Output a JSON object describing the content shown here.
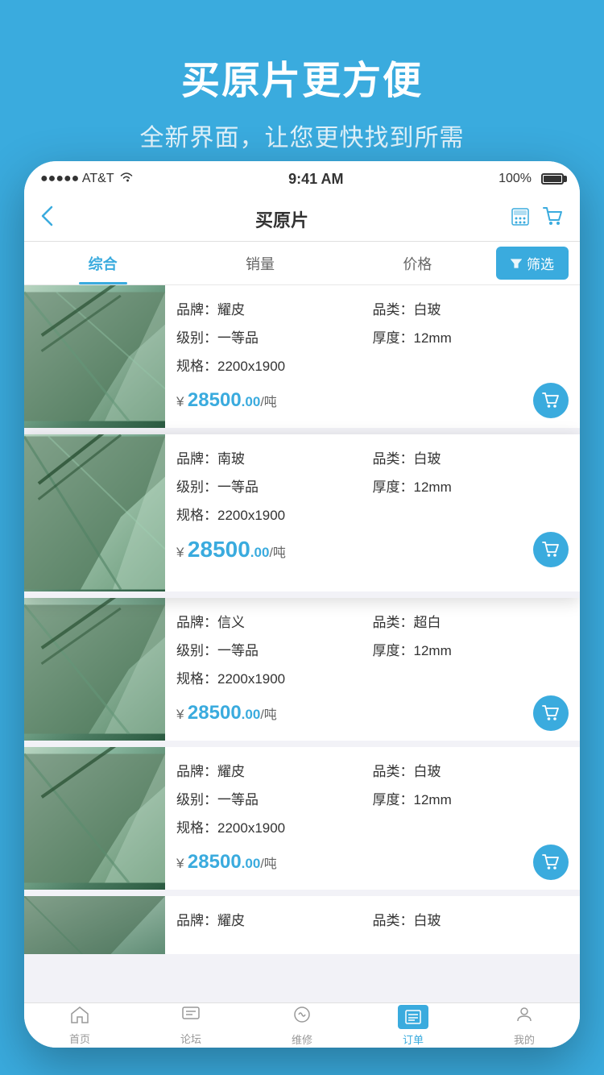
{
  "promo": {
    "title": "买原片更方便",
    "subtitle": "全新界面，让您更快找到所需"
  },
  "status_bar": {
    "carrier": "●●●●● AT&T",
    "wifi": "wifi",
    "time": "9:41 AM",
    "battery_pct": "100%"
  },
  "nav": {
    "back": "‹",
    "title": "买原片",
    "calc_icon": "calculator",
    "cart_icon": "cart"
  },
  "sort_tabs": [
    {
      "label": "综合",
      "active": true
    },
    {
      "label": "销量",
      "active": false
    },
    {
      "label": "价格",
      "active": false
    }
  ],
  "filter_btn": "筛选",
  "products": [
    {
      "brand_label": "品牌：",
      "brand_value": "耀皮",
      "category_label": "品类：",
      "category_value": "白玻",
      "grade_label": "级别：",
      "grade_value": "一等品",
      "thickness_label": "厚度：",
      "thickness_value": "12mm",
      "spec_label": "规格：",
      "spec_value": "2200x1900",
      "price_symbol": "¥",
      "price_main": "28500",
      "price_decimal": ".00",
      "price_unit": "/吨",
      "highlighted": false
    },
    {
      "brand_label": "品牌：",
      "brand_value": "南玻",
      "category_label": "品类：",
      "category_value": "白玻",
      "grade_label": "级别：",
      "grade_value": "一等品",
      "thickness_label": "厚度：",
      "thickness_value": "12mm",
      "spec_label": "规格：",
      "spec_value": "2200x1900",
      "price_symbol": "¥",
      "price_main": "28500",
      "price_decimal": ".00",
      "price_unit": "/吨",
      "highlighted": true
    },
    {
      "brand_label": "品牌：",
      "brand_value": "信义",
      "category_label": "品类：",
      "category_value": "超白",
      "grade_label": "级别：",
      "grade_value": "一等品",
      "thickness_label": "厚度：",
      "thickness_value": "12mm",
      "spec_label": "规格：",
      "spec_value": "2200x1900",
      "price_symbol": "¥",
      "price_main": "28500",
      "price_decimal": ".00",
      "price_unit": "/吨",
      "highlighted": false
    },
    {
      "brand_label": "品牌：",
      "brand_value": "耀皮",
      "category_label": "品类：",
      "category_value": "白玻",
      "grade_label": "级别：",
      "grade_value": "一等品",
      "thickness_label": "厚度：",
      "thickness_value": "12mm",
      "spec_label": "规格：",
      "spec_value": "2200x1900",
      "price_symbol": "¥",
      "price_main": "28500",
      "price_decimal": ".00",
      "price_unit": "/吨",
      "highlighted": false
    },
    {
      "brand_label": "品牌：",
      "brand_value": "耀皮",
      "category_label": "品类：",
      "category_value": "白玻",
      "grade_label": "级别：",
      "grade_value": "",
      "thickness_label": "",
      "thickness_value": "",
      "spec_label": "",
      "spec_value": "",
      "price_symbol": "",
      "price_main": "",
      "price_decimal": "",
      "price_unit": "",
      "highlighted": false,
      "partial": true
    }
  ],
  "tabs": [
    {
      "icon": "home",
      "label": "首页",
      "active": false
    },
    {
      "icon": "forum",
      "label": "论坛",
      "active": false
    },
    {
      "icon": "repair",
      "label": "维修",
      "active": false
    },
    {
      "icon": "order",
      "label": "订单",
      "active": true
    },
    {
      "icon": "mine",
      "label": "我的",
      "active": false
    }
  ]
}
